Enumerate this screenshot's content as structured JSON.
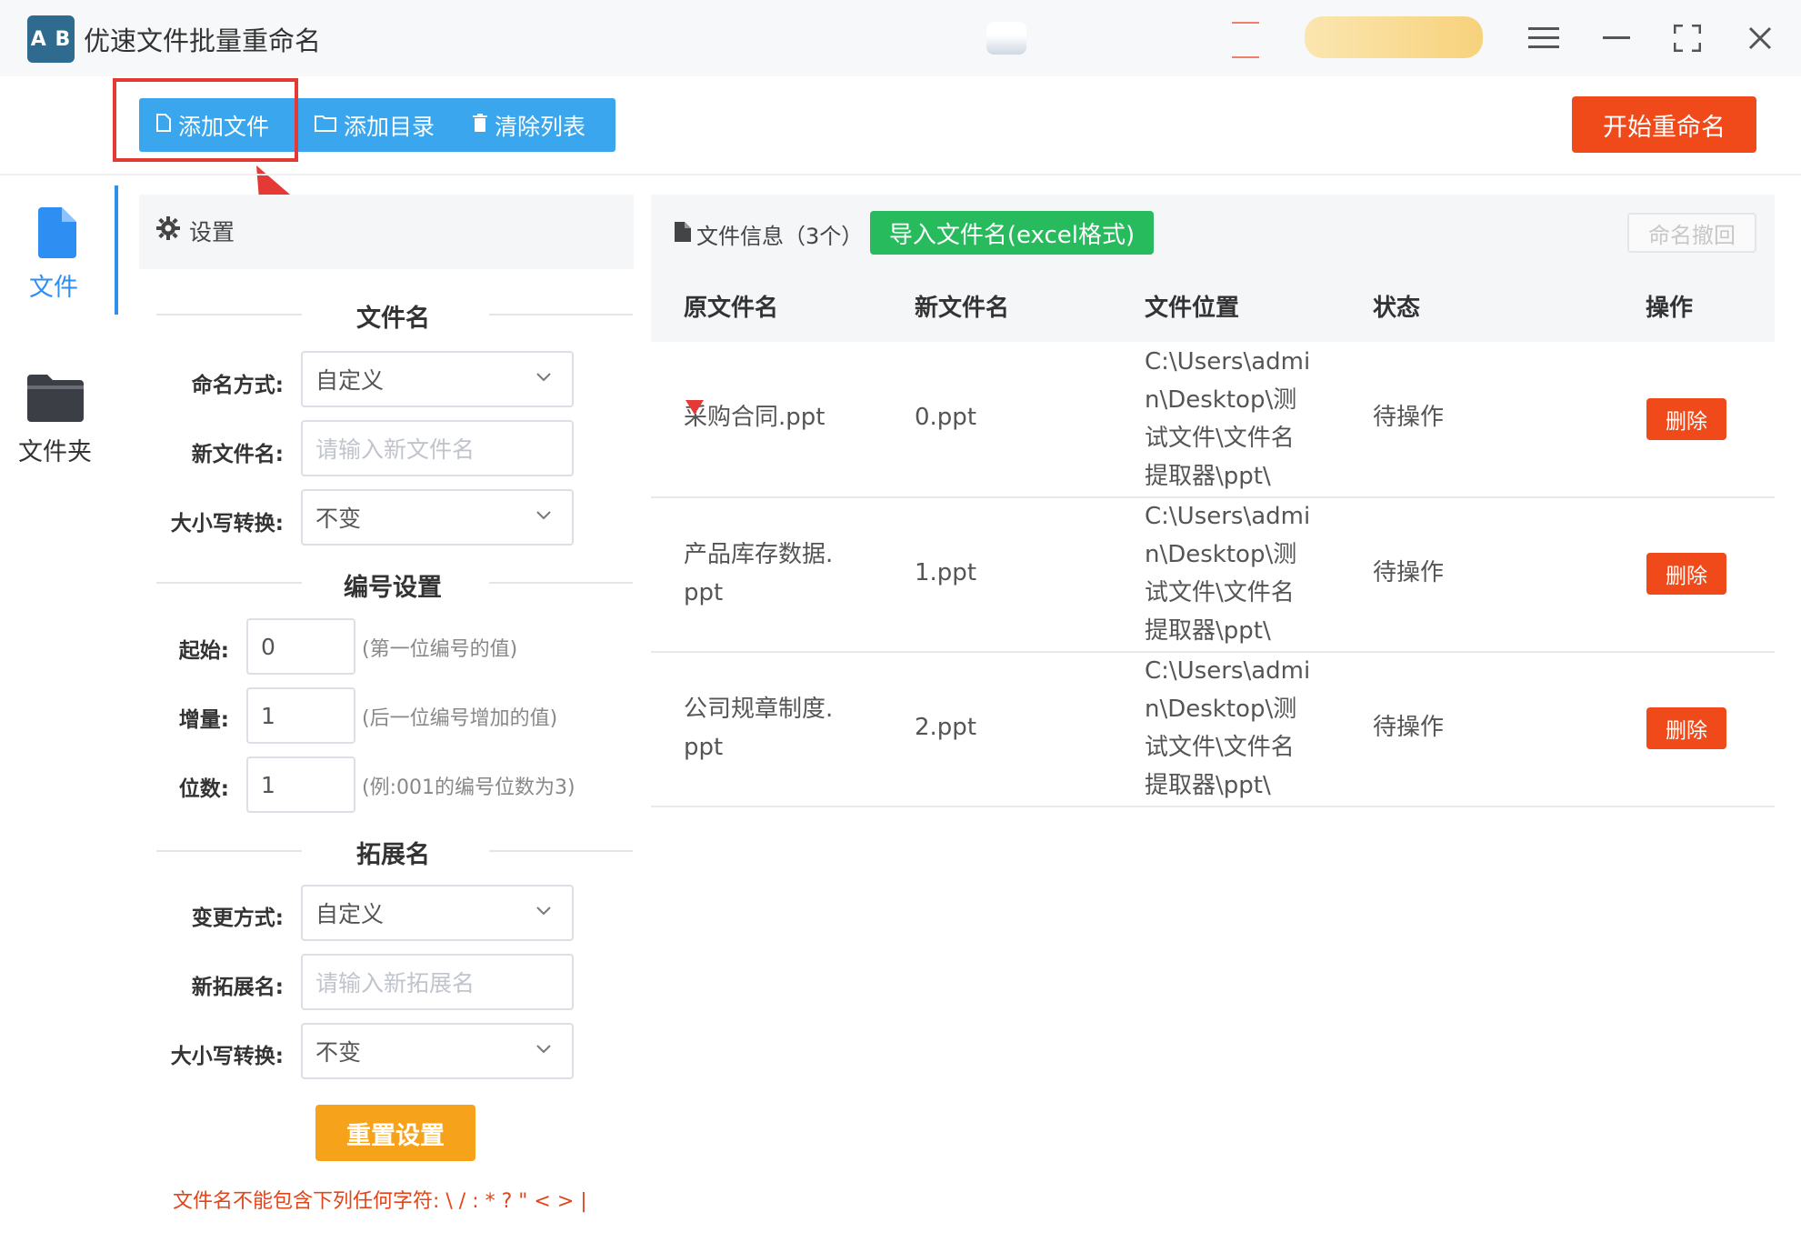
{
  "app": {
    "title": "优速文件批量重命名",
    "logo_text": "A B"
  },
  "window_controls": [
    "menu-icon",
    "minimize-icon",
    "maximize-icon",
    "close-icon"
  ],
  "toolbar": {
    "add_file": "添加文件",
    "add_dir": "添加目录",
    "clear_list": "清除列表",
    "start_rename": "开始重命名"
  },
  "nav": {
    "file": "文件",
    "folder": "文件夹"
  },
  "settings": {
    "header": "设置",
    "filename_section": "文件名",
    "naming_mode_label": "命名方式:",
    "naming_mode_value": "自定义",
    "new_name_label": "新文件名:",
    "new_name_placeholder": "请输入新文件名",
    "case_label": "大小写转换:",
    "case_value": "不变",
    "numbering_section": "编号设置",
    "start_label": "起始:",
    "start_value": "0",
    "start_hint": "(第一位编号的值)",
    "step_label": "增量:",
    "step_value": "1",
    "step_hint": "(后一位编号增加的值)",
    "digits_label": "位数:",
    "digits_value": "1",
    "digits_hint": "(例:001的编号位数为3)",
    "ext_section": "拓展名",
    "ext_mode_label": "变更方式:",
    "ext_mode_value": "自定义",
    "new_ext_label": "新拓展名:",
    "new_ext_placeholder": "请输入新拓展名",
    "ext_case_label": "大小写转换:",
    "ext_case_value": "不变",
    "reset_button": "重置设置",
    "warning": "文件名不能包含下列任何字符: \\ / : * ? \" < > |"
  },
  "file_info": {
    "title": "文件信息（3个）",
    "import_button": "导入文件名(excel格式)",
    "undo_button": "命名撤回",
    "columns": [
      "原文件名",
      "新文件名",
      "文件位置",
      "状态",
      "操作"
    ],
    "rows": [
      {
        "orig": [
          "采购合同.ppt"
        ],
        "new": "0.ppt",
        "path": [
          "C:\\Users\\admi",
          "n\\Desktop\\测",
          "试文件\\文件名",
          "提取器\\ppt\\"
        ],
        "status": "待操作",
        "action": "删除"
      },
      {
        "orig": [
          "产品库存数据.",
          "ppt"
        ],
        "new": "1.ppt",
        "path": [
          "C:\\Users\\admi",
          "n\\Desktop\\测",
          "试文件\\文件名",
          "提取器\\ppt\\"
        ],
        "status": "待操作",
        "action": "删除"
      },
      {
        "orig": [
          "公司规章制度.",
          "ppt"
        ],
        "new": "2.ppt",
        "path": [
          "C:\\Users\\admi",
          "n\\Desktop\\测",
          "试文件\\文件名",
          "提取器\\ppt\\"
        ],
        "status": "待操作",
        "action": "删除"
      }
    ]
  },
  "colors": {
    "primary_blue": "#3aa6ee",
    "accent_red": "#f04a1a",
    "green": "#27bb5d",
    "orange": "#f7a21b"
  }
}
